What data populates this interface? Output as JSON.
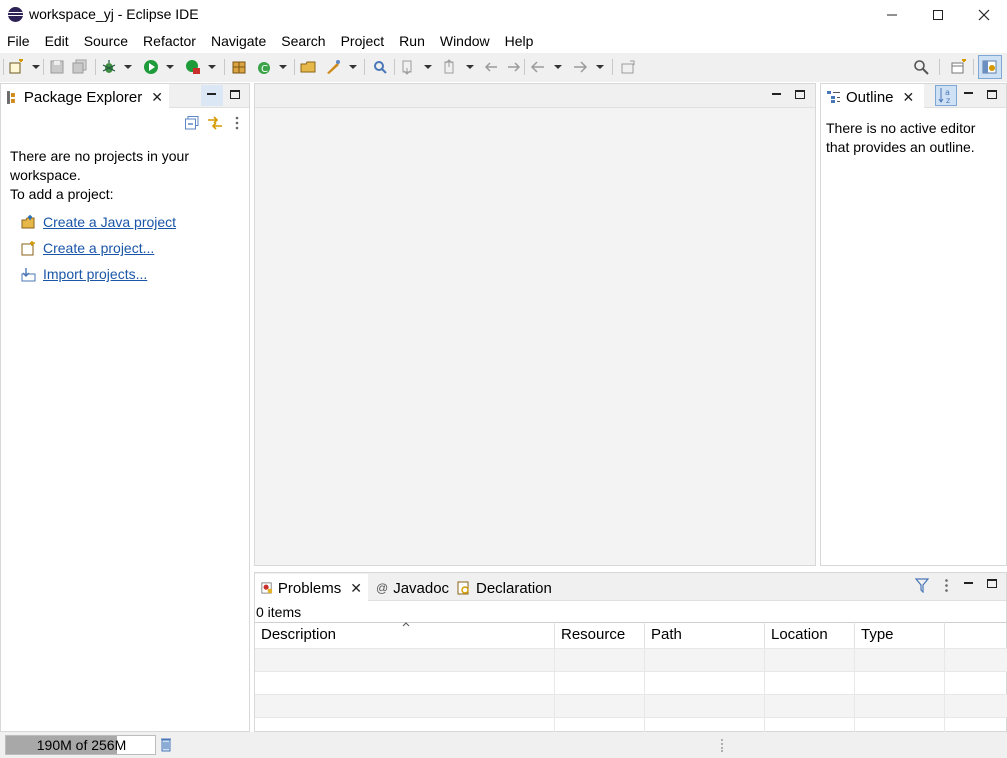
{
  "window": {
    "title": "workspace_yj - Eclipse IDE",
    "controls": {
      "minimize": "minimize-icon",
      "maximize": "maximize-icon",
      "close": "close-icon"
    }
  },
  "menu": [
    "File",
    "Edit",
    "Source",
    "Refactor",
    "Navigate",
    "Search",
    "Project",
    "Run",
    "Window",
    "Help"
  ],
  "toolbar": {
    "icons": [
      "new-icon",
      "save-icon",
      "save-all-icon",
      "debug-icon",
      "run-icon",
      "coverage-icon",
      "new-package-icon",
      "new-class-icon",
      "open-type-icon",
      "open-resource-icon",
      "search-icon",
      "perspective-icon",
      "java-perspective-icon"
    ]
  },
  "package_explorer": {
    "tab_label": "Package Explorer",
    "message_line1": "There are no projects in your",
    "message_line2": "workspace.",
    "message_line3": "To add a project:",
    "links": [
      "Create a Java project",
      "Create a project...",
      "Import projects..."
    ]
  },
  "outline": {
    "tab_label": "Outline",
    "message_line1": "There is no active editor",
    "message_line2": "that provides an outline."
  },
  "bottom_panel": {
    "tabs": [
      "Problems",
      "Javadoc",
      "Declaration"
    ],
    "items_count": "0 items",
    "columns": [
      "Description",
      "Resource",
      "Path",
      "Location",
      "Type"
    ]
  },
  "status": {
    "heap_text": "190M of 256M",
    "heap_fraction": 0.742
  },
  "colors": {
    "link": "#1a56a8",
    "toolbar_bg": "#f0f0f0",
    "panel_bg": "#ffffff",
    "editor_bg": "#f3f3f3"
  }
}
